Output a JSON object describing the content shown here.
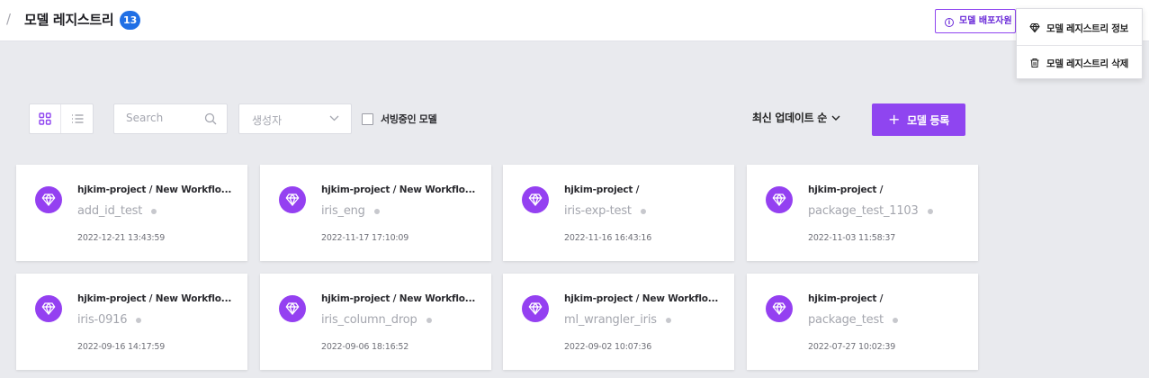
{
  "header": {
    "separator": "/",
    "title": "모델 레지스트리",
    "count": "13",
    "deploy_button_label": "모델 배포자원",
    "deploy_button_icon": "info-icon"
  },
  "menu": {
    "items": [
      {
        "label": "모델 레지스트리 정보",
        "icon": "diamond-icon"
      },
      {
        "label": "모델 레지스트리 삭제",
        "icon": "trash-icon"
      }
    ]
  },
  "toolbar": {
    "search_placeholder": "Search",
    "creator_placeholder": "생성자",
    "serving_filter_label": "서빙중인 모델",
    "serving_filter_checked": false,
    "sort_label": "최신 업데이트 순",
    "register_label": "모델 등록",
    "active_view": "grid"
  },
  "colors": {
    "accent": "#8f45f0",
    "badge": "#1f6fe5",
    "background": "#e9eaee"
  },
  "cards": [
    {
      "project": "hjkim-project / New Workflo...",
      "name": "add_id_test",
      "date": "2022-12-21 13:43:59"
    },
    {
      "project": "hjkim-project / New Workflo...",
      "name": "iris_eng",
      "date": "2022-11-17 17:10:09"
    },
    {
      "project": "hjkim-project /",
      "name": "iris-exp-test",
      "date": "2022-11-16 16:43:16"
    },
    {
      "project": "hjkim-project /",
      "name": "package_test_1103",
      "date": "2022-11-03 11:58:37"
    },
    {
      "project": "hjkim-project / New Workflo...",
      "name": "iris-0916",
      "date": "2022-09-16 14:17:59"
    },
    {
      "project": "hjkim-project / New Workflo...",
      "name": "iris_column_drop",
      "date": "2022-09-06 18:16:52"
    },
    {
      "project": "hjkim-project / New Workflo...",
      "name": "ml_wrangler_iris",
      "date": "2022-09-02 10:07:36"
    },
    {
      "project": "hjkim-project /",
      "name": "package_test",
      "date": "2022-07-27 10:02:39"
    }
  ]
}
